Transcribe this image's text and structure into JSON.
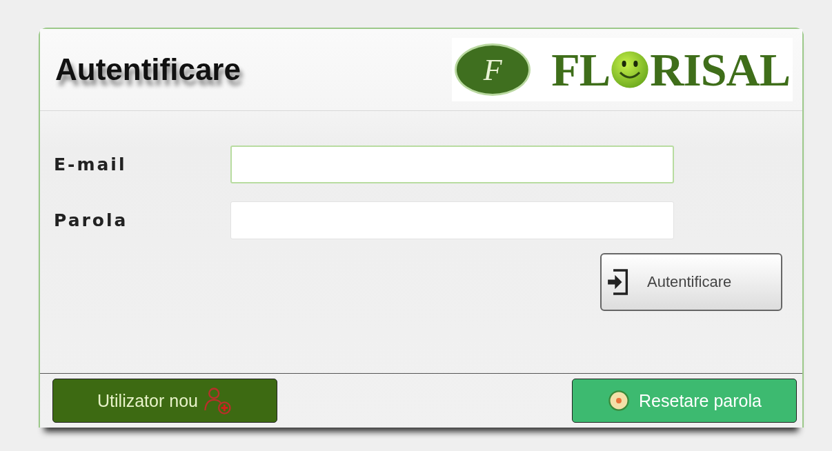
{
  "header": {
    "title": "Autentificare",
    "logo": {
      "monogram": "F",
      "text_before": "FL",
      "text_after": "RISAL"
    }
  },
  "fields": [
    {
      "label": "E-mail",
      "focused": true
    },
    {
      "label": "Parola",
      "focused": false
    }
  ],
  "submit_button": "Autentificare",
  "footer": {
    "new_user_button": "Utilizator nou",
    "reset_button": "Resetare parola"
  }
}
